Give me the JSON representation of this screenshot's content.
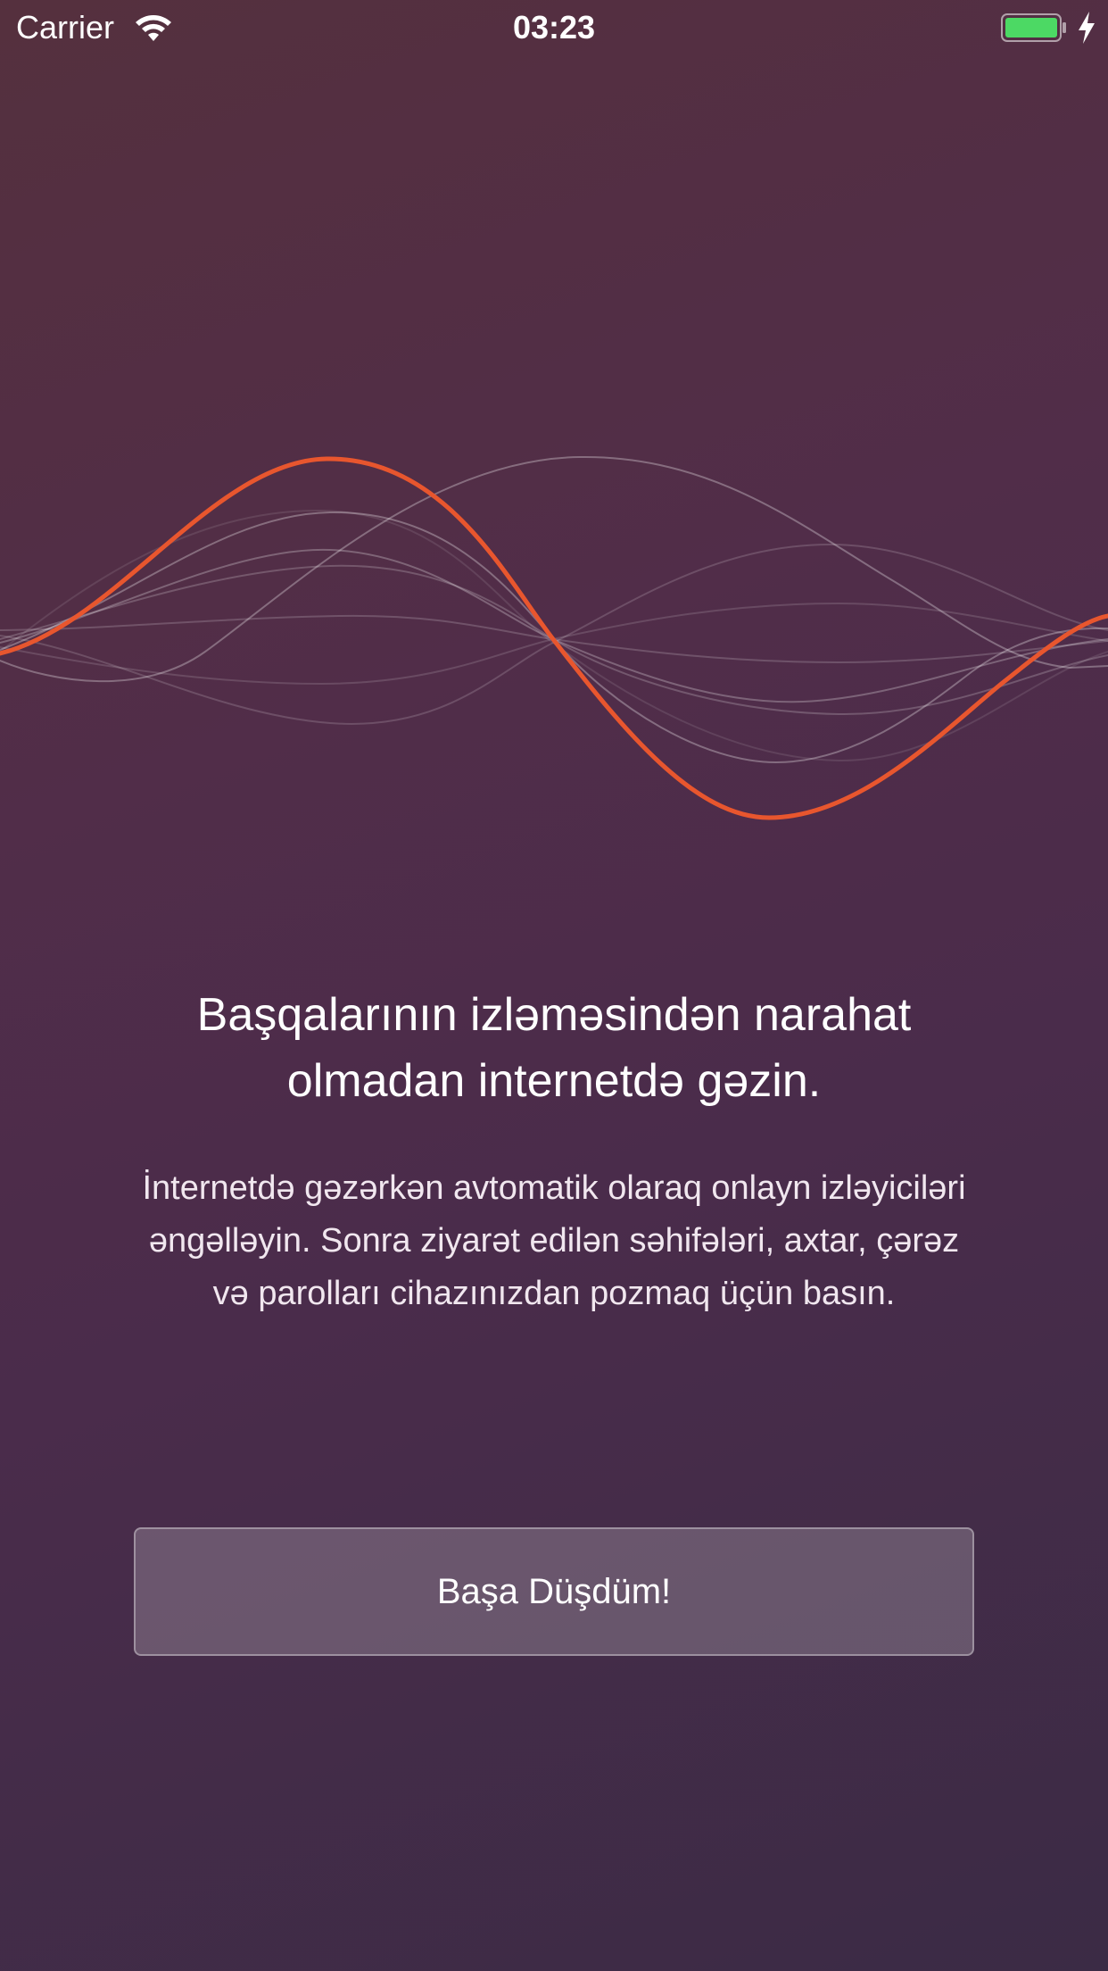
{
  "status_bar": {
    "carrier": "Carrier",
    "time": "03:23",
    "battery_level": 1.0,
    "charging": true,
    "wifi_icon": "wifi-icon",
    "battery_icon": "battery-icon",
    "bolt_icon": "charging-bolt-icon"
  },
  "onboarding": {
    "headline": "Başqalarının izləməsindən narahat olmadan internetdə gəzin.",
    "description": "İnternetdə gəzərkən avtomatik olaraq onlayn izləyiciləri əngəlləyin. Sonra ziyarət edilən səhifələri, axtar, çərəz və parolları cihazınızdan pozmaq üçün basın.",
    "button_label": "Başa Düşdüm!"
  },
  "colors": {
    "accent": "#e8562e",
    "background_top": "#55303e",
    "background_bottom": "#3b2b45",
    "battery": "#4cd964"
  }
}
